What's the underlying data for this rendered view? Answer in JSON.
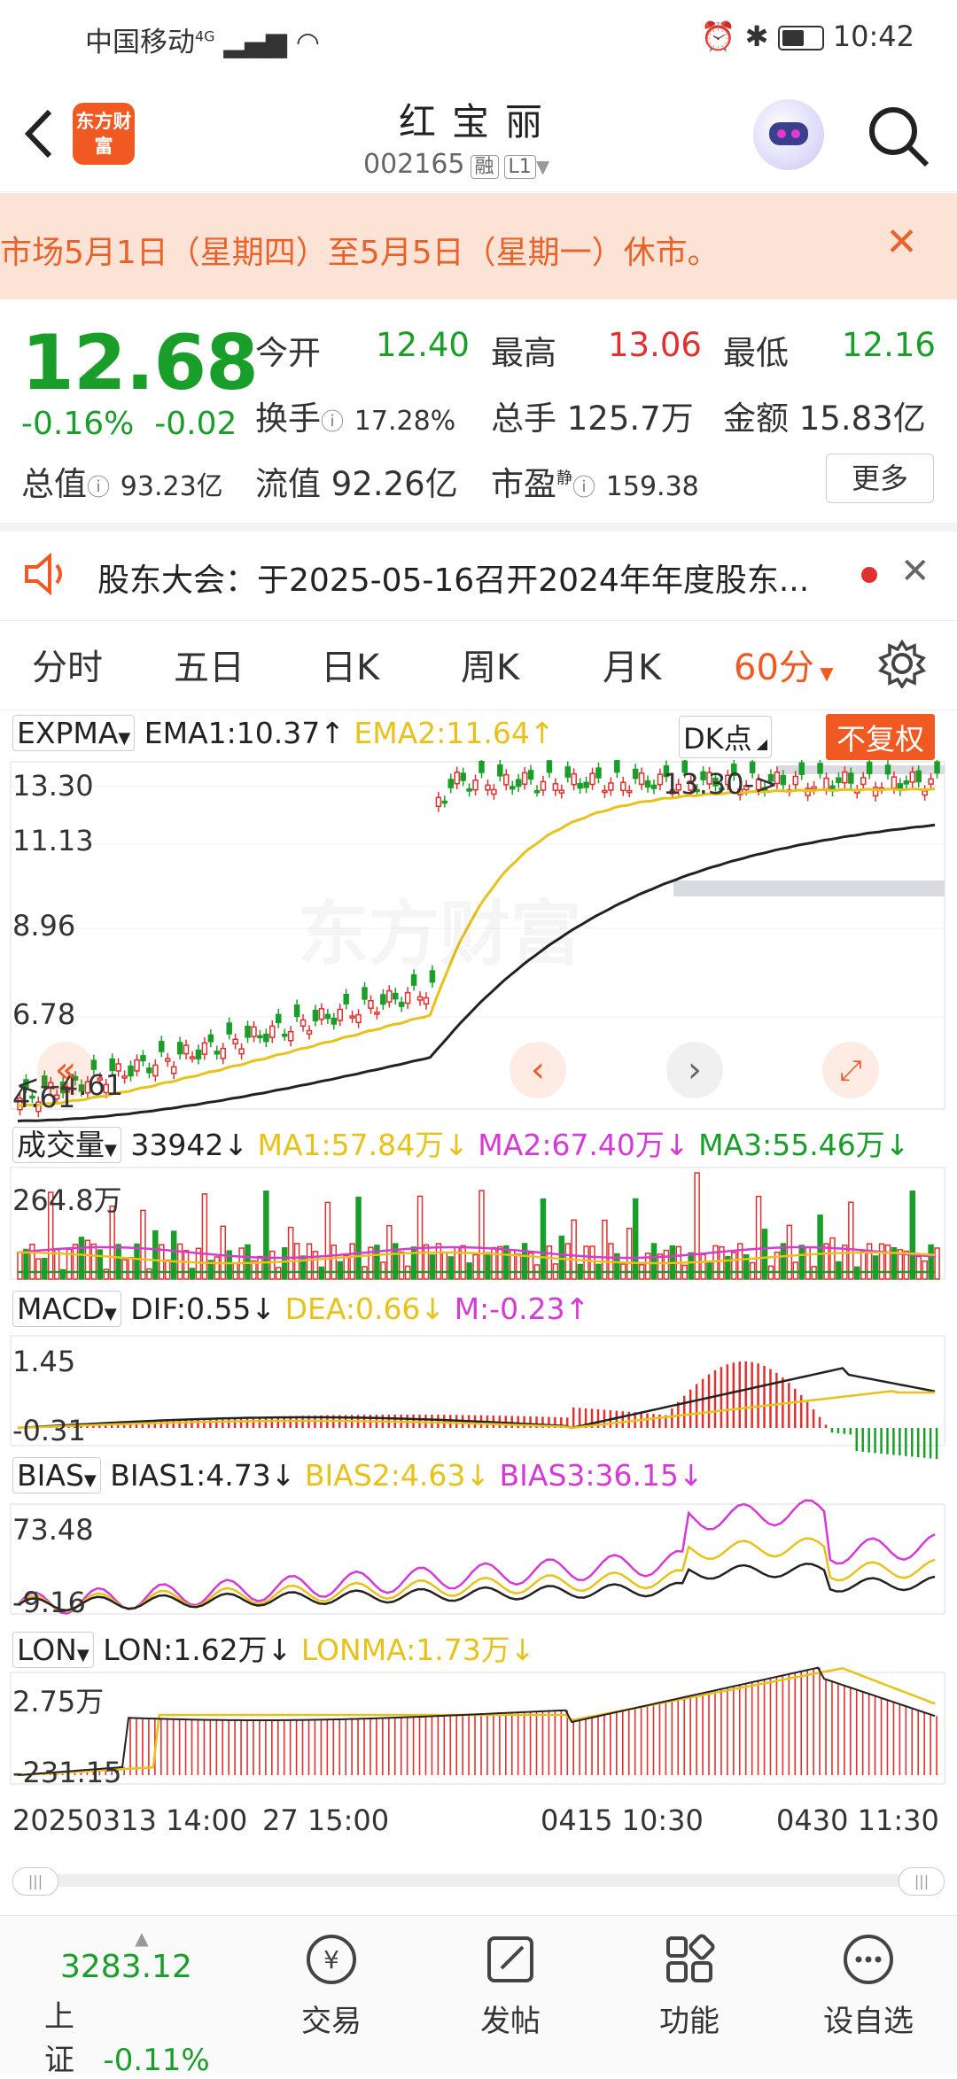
{
  "status_bar": {
    "carrier": "中国移动",
    "net": "4G",
    "time": "10:42"
  },
  "header": {
    "logo_text": "东方财富",
    "stock_name": "红宝丽",
    "stock_code": "002165",
    "tag1": "融",
    "tag2": "L1"
  },
  "notice": {
    "text": "市场5月1日（星期四）至5月5日（星期一）休市。"
  },
  "quote": {
    "price": "12.68",
    "change_pct": "-0.16%",
    "change": "-0.02",
    "open_label": "今开",
    "open": "12.40",
    "high_label": "最高",
    "high": "13.06",
    "low_label": "最低",
    "low": "12.16",
    "turnover_label": "换手",
    "turnover": "17.28%",
    "volume_label": "总手",
    "volume": "125.7万",
    "amount_label": "金额",
    "amount": "15.83亿",
    "mcap_label": "总值",
    "mcap": "93.23亿",
    "float_label": "流值",
    "float": "92.26亿",
    "pe_label": "市盈",
    "pe_sup": "静",
    "pe": "159.38",
    "more_label": "更多"
  },
  "meeting": {
    "text": "股东大会：于2025-05-16召开2024年年度股东..."
  },
  "tabs": [
    {
      "label": "分时"
    },
    {
      "label": "五日"
    },
    {
      "label": "日K"
    },
    {
      "label": "周K"
    },
    {
      "label": "月K"
    },
    {
      "label": "60分",
      "active": true
    }
  ],
  "chart": {
    "main": {
      "indicator": "EXPMA",
      "ema1": "EMA1:10.37↑",
      "ema2": "EMA2:11.64↑",
      "dk_label": "DK点",
      "fq_label": "不复权",
      "y_labels": [
        "13.30",
        "11.13",
        "8.96",
        "6.78",
        "4.61"
      ],
      "max_marker": "13.30->",
      "min_marker": "<--4.61",
      "watermark": "东方财富"
    },
    "vol": {
      "indicator": "成交量",
      "value": "33942↓",
      "ma1": "MA1:57.84万↓",
      "ma2": "MA2:67.40万↓",
      "ma3": "MA3:55.46万↓",
      "y_top": "264.8万"
    },
    "macd": {
      "indicator": "MACD",
      "dif": "DIF:0.55↓",
      "dea": "DEA:0.66↓",
      "m": "M:-0.23↑",
      "y_top": "1.45",
      "y_bottom": "-0.31"
    },
    "bias": {
      "indicator": "BIAS",
      "b1": "BIAS1:4.73↓",
      "b2": "BIAS2:4.63↓",
      "b3": "BIAS3:36.15↓",
      "y_top": "73.48",
      "y_bottom": "-9.16"
    },
    "lon": {
      "indicator": "LON",
      "lon": "LON:1.62万↓",
      "lonma": "LONMA:1.73万↓",
      "y_top": "2.75万",
      "y_bottom": "-231.15"
    },
    "x_labels": [
      "20250313 14:00",
      "27 15:00",
      "0415 10:30",
      "0430 11:30"
    ]
  },
  "colors": {
    "up": "#e0302f",
    "down": "#1a9e2a",
    "ema1": "#222222",
    "ema2": "#e8c21a",
    "ma2": "#d63ad6",
    "ma3": "#1a9e2a",
    "accent": "#f05a22"
  },
  "bottom_nav": {
    "index_value": "3283.12",
    "index_name": "上证",
    "index_change": "-0.11%",
    "items": [
      {
        "label": "交易",
        "icon": "yen-circle-icon"
      },
      {
        "label": "发帖",
        "icon": "edit-icon"
      },
      {
        "label": "功能",
        "icon": "grid-icon"
      },
      {
        "label": "设自选",
        "icon": "more-icon"
      }
    ]
  }
}
